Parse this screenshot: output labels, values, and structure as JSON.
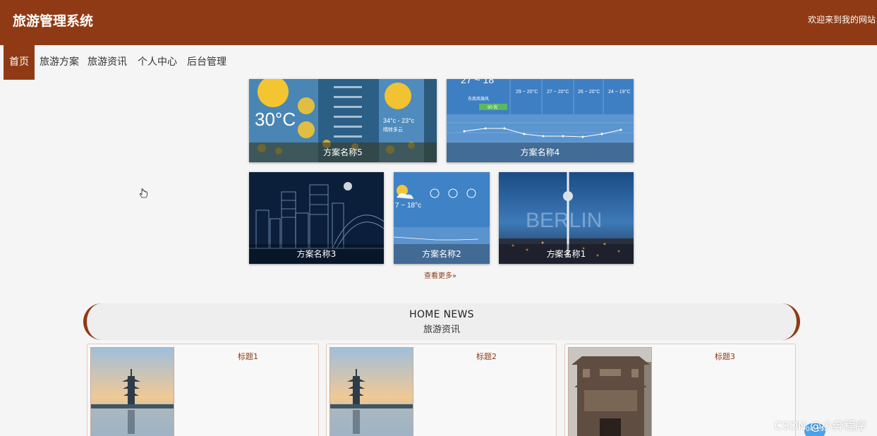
{
  "header": {
    "site_title": "旅游管理系统",
    "welcome": "欢迎来到我的网站"
  },
  "nav": {
    "items": [
      {
        "label": "首页",
        "active": true
      },
      {
        "label": "旅游方案",
        "active": false
      },
      {
        "label": "旅游资讯",
        "active": false
      },
      {
        "label": "个人中心",
        "active": false
      },
      {
        "label": "后台管理",
        "active": false
      }
    ]
  },
  "plans": {
    "cards": [
      {
        "label": "方案名称5",
        "image": "weather-app-screenshot"
      },
      {
        "label": "方案名称4",
        "image": "weather-forecast-chart"
      },
      {
        "label": "方案名称3",
        "image": "city-line-art-night"
      },
      {
        "label": "方案名称2",
        "image": "weather-forecast-small"
      },
      {
        "label": "方案名称1",
        "image": "berlin-tv-tower"
      }
    ],
    "weather5": {
      "temp": "30°C",
      "range": "34°c - 23°c",
      "desc": "晴转多云"
    },
    "weather4": {
      "range1": "29 ~ 20°C",
      "range2": "27 ~ 20°C",
      "range3": "26 ~ 20°C",
      "range4": "24 ~ 19°C",
      "wind": "东南风微风",
      "aqi": "90 优"
    },
    "weather2": {
      "range": "7 ~ 18°c"
    },
    "berlin_text": "BERLIN",
    "more_label": "查看更多»"
  },
  "news": {
    "heading_en": "HOME NEWS",
    "heading_cn": "旅游资讯",
    "items": [
      {
        "title": "标题1",
        "image": "pagoda-lake-sunset"
      },
      {
        "title": "标题2",
        "image": "pagoda-lake-sunset"
      },
      {
        "title": "标题3",
        "image": "ancient-stone-gate"
      }
    ]
  },
  "overlay": {
    "watermark": "CSDN @小奔程序",
    "time_badge": "04:19"
  },
  "colors": {
    "brand": "#8f3a14",
    "background": "#f5f5f5"
  }
}
